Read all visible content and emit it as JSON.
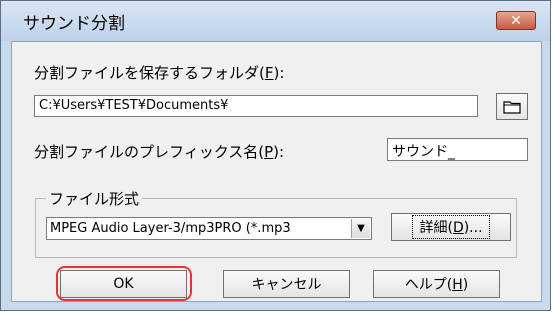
{
  "window": {
    "title": "サウンド分割",
    "close_label": "✕"
  },
  "folder": {
    "label_prefix": "分割ファイルを保存するフォルダ(",
    "label_key": "F",
    "label_suffix": "):",
    "path": "C:¥Users¥TEST¥Documents¥",
    "browse_icon": "folder-icon"
  },
  "prefix": {
    "label_prefix": "分割ファイルのプレフィックス名(",
    "label_key": "P",
    "label_suffix": "):",
    "value": "サウンド_"
  },
  "format": {
    "group_label": "ファイル形式",
    "selected": "MPEG Audio Layer-3/mp3PRO (*.mp3",
    "details_prefix": "詳細(",
    "details_key": "D",
    "details_suffix": ")..."
  },
  "buttons": {
    "ok": "OK",
    "cancel": "キャンセル",
    "help_prefix": "ヘルプ(",
    "help_key": "H",
    "help_suffix": ")"
  },
  "colors": {
    "highlight": "#e53434",
    "close": "#c75a43"
  }
}
